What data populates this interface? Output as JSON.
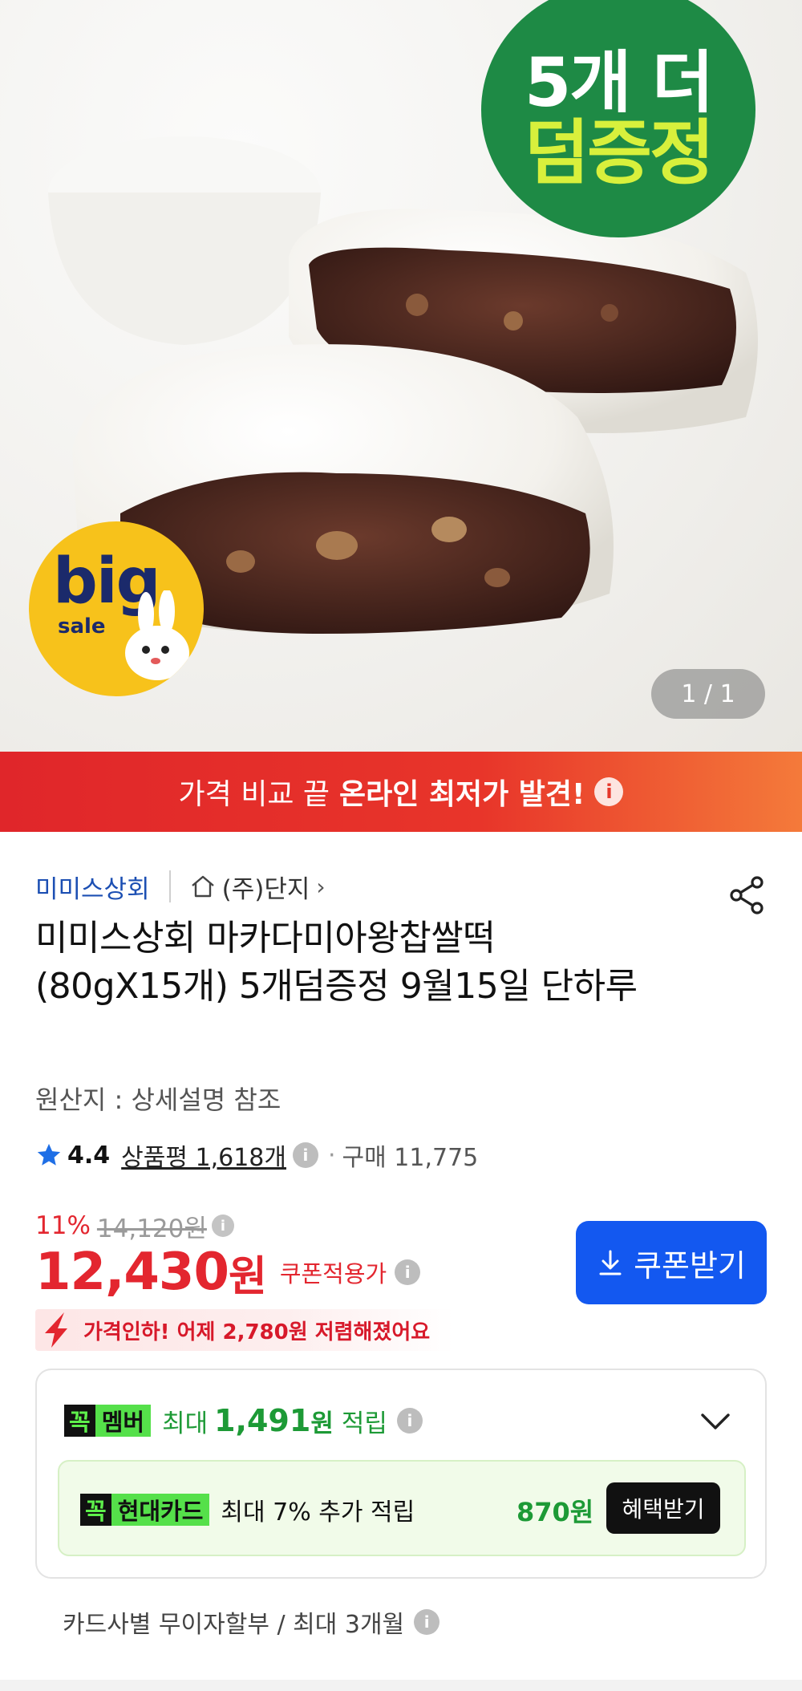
{
  "hero": {
    "badge_top_line": "5개 더",
    "badge_bottom_line": "덤증정",
    "sale_badge_big": "big",
    "sale_badge_sale": "sale",
    "pager": "1 / 1"
  },
  "banner": {
    "prefix": "가격 비교 끝",
    "highlight": "온라인 최저가 발견!",
    "info_icon": "i"
  },
  "product": {
    "seller": "미미스상회",
    "store": "(주)단지",
    "store_chevron": "›",
    "title": "미미스상회 마카다미아왕찹쌀떡 (80gX15개) 5개덤증정 9월15일 단하루",
    "origin": "원산지 : 상세설명 참조",
    "rating": "4.4",
    "reviews": "상품평 1,618개",
    "info_icon": "i",
    "dot": "·",
    "purchases": "구매 11,775",
    "discount_pct": "11%",
    "original_price": "14,120원",
    "price": "12,430",
    "price_unit": "원",
    "coupon_label": "쿠폰적용가",
    "coupon_button": "쿠폰받기",
    "price_drop": "가격인하! 어제 2,780원 저렴해졌어요"
  },
  "benefits": {
    "member_tag_k": "꼭",
    "member_tag_label": "멤버",
    "member_prefix": "최대",
    "member_amount": "1,491",
    "member_won": "원",
    "member_suffix": "적립",
    "card_tag_k": "꼭",
    "card_tag_label": "현대카드",
    "card_desc": "최대 7% 추가 적립",
    "card_amount": "870원",
    "card_button": "혜택받기",
    "installment": "카드사별 무이자할부 / 최대 3개월"
  },
  "colors": {
    "accent_red": "#e3262f",
    "coupon_blue": "#1358f0",
    "green": "#1d9a36",
    "badge_green": "#1e8a45"
  },
  "icons": [
    "home-icon",
    "share-icon",
    "star-icon",
    "info-icon",
    "download-icon",
    "chevron-down-icon",
    "price-drop-arrow-icon",
    "bunny-icon"
  ]
}
